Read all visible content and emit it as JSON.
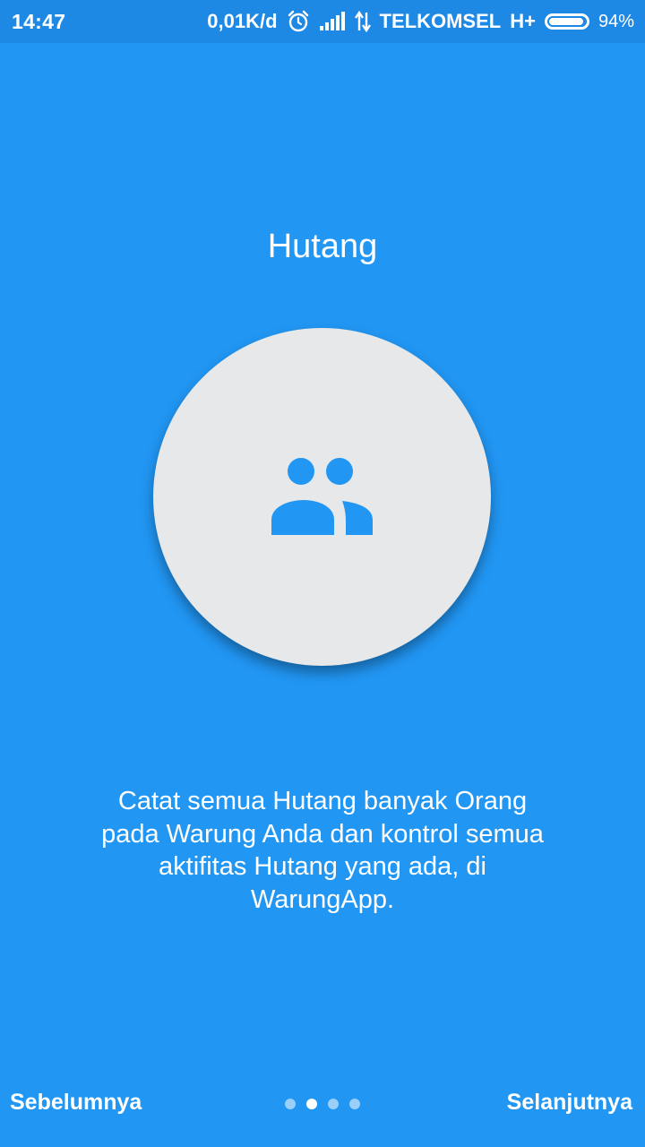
{
  "status_bar": {
    "time": "14:47",
    "speed": "0,01K/d",
    "carrier": "TELKOMSEL",
    "network": "H+",
    "battery_percent": "94%",
    "battery_level": 0.94,
    "icons": [
      "alarm-icon",
      "signal-icon",
      "data-transfer-icon",
      "battery-icon"
    ]
  },
  "onboarding": {
    "title": "Hutang",
    "icon": "people-icon",
    "description": "Catat semua Hutang banyak Orang pada Warung Anda dan kontrol semua aktifitas Hutang yang ada, di WarungApp.",
    "page_count": 4,
    "current_page": 2
  },
  "navigation": {
    "prev_label": "Sebelumnya",
    "next_label": "Selanjutnya"
  },
  "colors": {
    "background": "#2196F3",
    "status_bar": "#1E88E5",
    "circle": "#E6E8E9",
    "icon": "#2196F3"
  }
}
